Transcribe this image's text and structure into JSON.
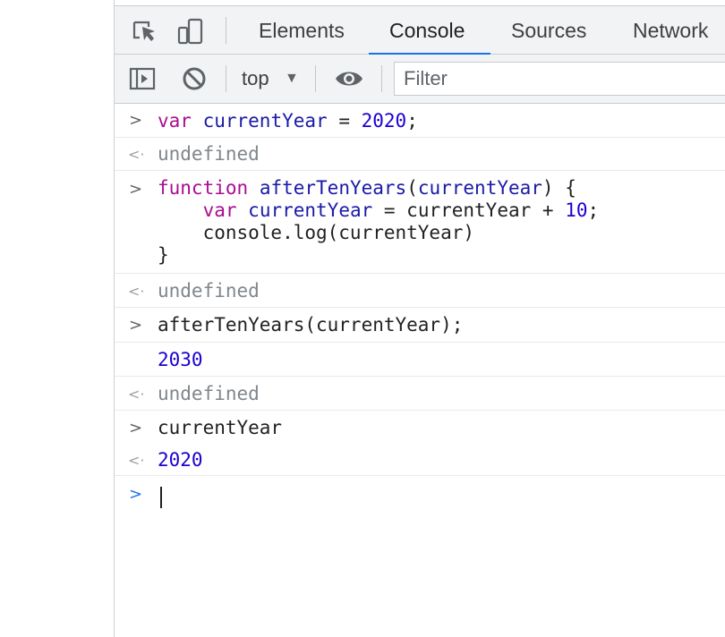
{
  "tabs": [
    "Elements",
    "Console",
    "Sources",
    "Network"
  ],
  "active_tab": "Console",
  "toolbar": {
    "context": "top",
    "filter_placeholder": "Filter"
  },
  "console": {
    "entries": [
      {
        "type": "input",
        "code": "var currentYear = 2020;"
      },
      {
        "type": "result",
        "value": "undefined"
      },
      {
        "type": "input",
        "lines": [
          "function afterTenYears(currentYear) {",
          "    var currentYear = currentYear + 10;",
          "    console.log(currentYear)",
          "}"
        ]
      },
      {
        "type": "result",
        "value": "undefined"
      },
      {
        "type": "input",
        "code": "afterTenYears(currentYear);"
      },
      {
        "type": "log",
        "value": "2030"
      },
      {
        "type": "result",
        "value": "undefined"
      },
      {
        "type": "input",
        "code": "currentYear"
      },
      {
        "type": "result",
        "value": "2020"
      }
    ]
  },
  "colors": {
    "keyword": "#aa0d91",
    "variable": "#1a1aa6",
    "number": "#1c00cf",
    "accent": "#1a73e8"
  }
}
